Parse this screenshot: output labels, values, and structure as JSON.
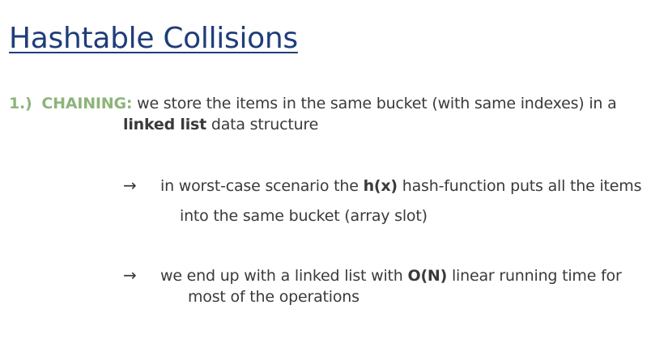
{
  "slide": {
    "title": "Hashtable Collisions",
    "point1": {
      "number": "1.)",
      "keyword": "CHAINING:",
      "line1": " we store the items in the same bucket (with same indexes) in a",
      "line2_bold": "linked list",
      "line2_rest": " data structure"
    },
    "bullet1": {
      "arrow": "→",
      "pre": "in worst-case scenario the ",
      "bold": "h(x)",
      "post": " hash-function puts all the items",
      "line2": "into the same bucket (array slot)"
    },
    "bullet2": {
      "arrow": "→",
      "pre": "we end up with a linked list with ",
      "bold": "O(N)",
      "post": " linear running time for",
      "line2": "most of the operations"
    }
  }
}
